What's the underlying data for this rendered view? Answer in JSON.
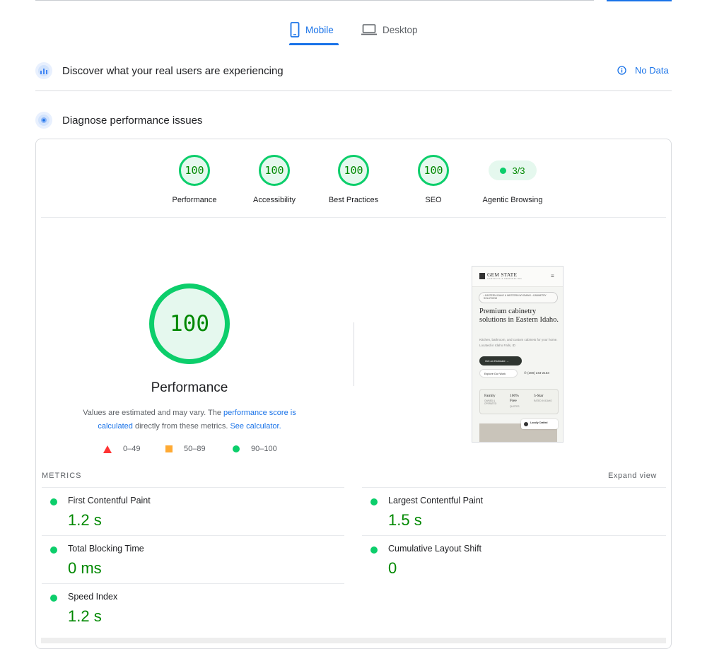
{
  "tabs": {
    "mobile": "Mobile",
    "desktop": "Desktop"
  },
  "field": {
    "title": "Discover what your real users are experiencing",
    "status": "No Data"
  },
  "lab": {
    "title": "Diagnose performance issues"
  },
  "categories": [
    {
      "score": "100",
      "label": "Performance"
    },
    {
      "score": "100",
      "label": "Accessibility"
    },
    {
      "score": "100",
      "label": "Best Practices"
    },
    {
      "score": "100",
      "label": "SEO"
    }
  ],
  "agentic": {
    "score": "3/3",
    "label": "Agentic Browsing"
  },
  "performance": {
    "score": "100",
    "title": "Performance",
    "desc_pre": "Values are estimated and may vary. The ",
    "desc_link1": "performance score is calculated",
    "desc_mid": " directly from these metrics. ",
    "desc_link2": "See calculator."
  },
  "legend": [
    {
      "range": "0–49",
      "color": "#ff3333"
    },
    {
      "range": "50–89",
      "color": "#ffaa33"
    },
    {
      "range": "90–100",
      "color": "#0cce6b"
    }
  ],
  "screenshot": {
    "brand": "GEM STATE",
    "brand_sub": "CABINETS & REMODELING",
    "badge": "• EASTERN IDAHO & WESTERN WYOMING • CABINETRY SOLUTIONS",
    "headline": "Premium cabinetry solutions in Eastern Idaho.",
    "paragraph": "Kitchen, bathroom, and custom cabinets for your home. Located in Idaho Falls, ID",
    "cta": "Get an Estimate →",
    "cta2": "Explore Our Work",
    "phone": "(208) 243-2153",
    "stat1": "Family",
    "stat1_sub": "OWNED & OPERATED",
    "stat2": "100%",
    "stat2_title": "Free",
    "stat2_sub": "QUOTES",
    "stat3": "5-Star",
    "stat3_sub": "RATED IN IDAHO",
    "tag": "Locally Crafted"
  },
  "metrics": {
    "heading": "METRICS",
    "expand": "Expand view",
    "items": [
      {
        "label": "First Contentful Paint",
        "value": "1.2 s"
      },
      {
        "label": "Largest Contentful Paint",
        "value": "1.5 s"
      },
      {
        "label": "Total Blocking Time",
        "value": "0 ms"
      },
      {
        "label": "Cumulative Layout Shift",
        "value": "0"
      },
      {
        "label": "Speed Index",
        "value": "1.2 s"
      }
    ]
  },
  "colors": {
    "accent": "#1a73e8",
    "pass": "#0cce6b",
    "pass_text": "#008800"
  }
}
